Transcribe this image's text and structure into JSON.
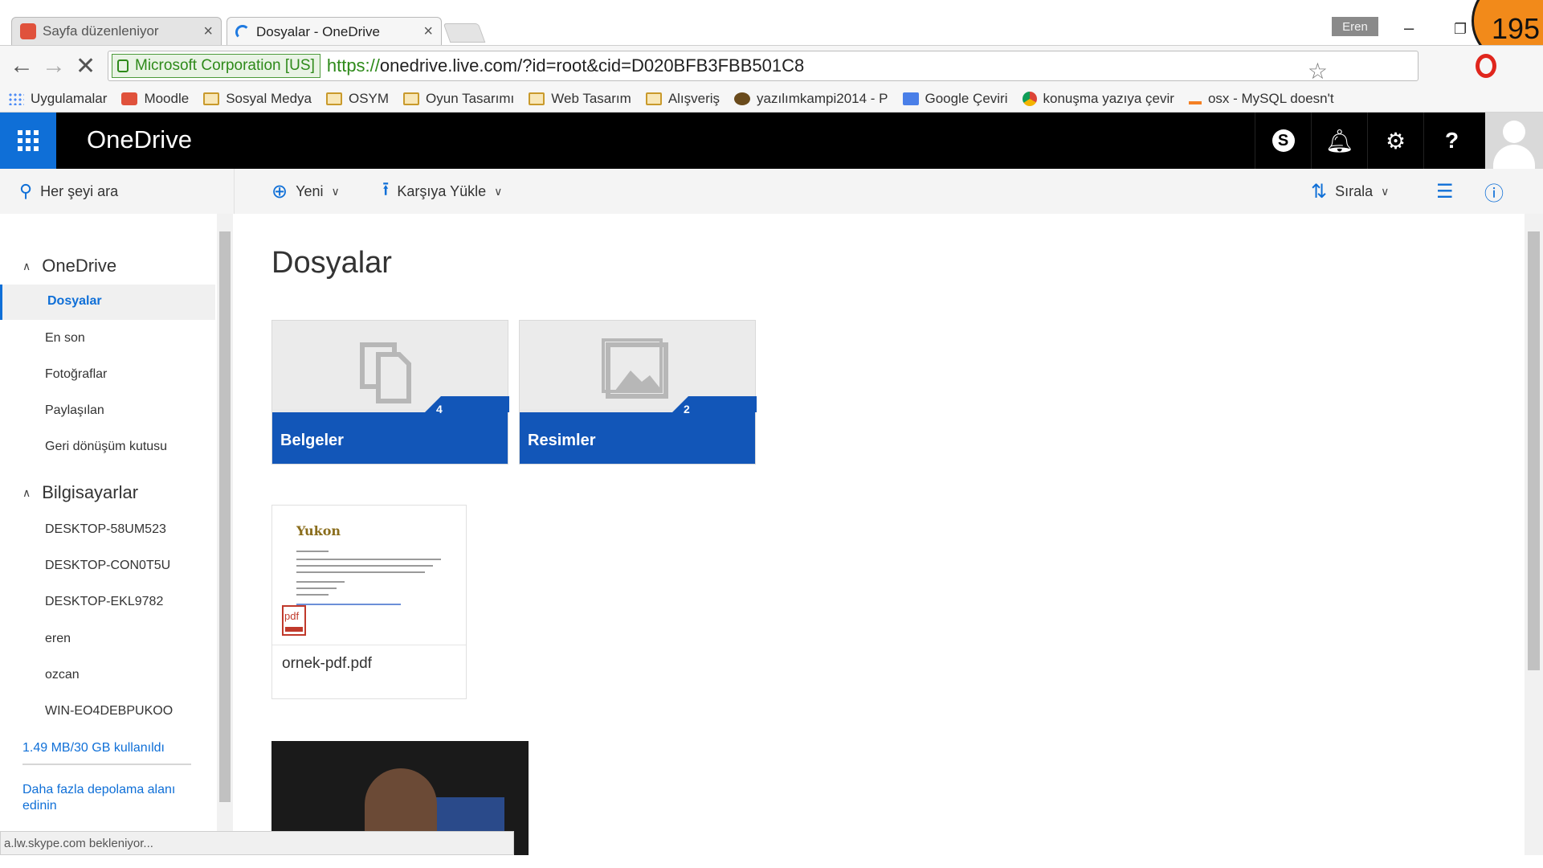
{
  "browser": {
    "tabs": [
      {
        "title": "Sayfa düzenleniyor",
        "active": false
      },
      {
        "title": "Dosyalar - OneDrive",
        "active": true
      }
    ],
    "profile_name": "Eren",
    "slide_counter": "195",
    "security_label": "Microsoft Corporation [US]",
    "url_scheme": "https://",
    "url_rest": "onedrive.live.com/?id=root&cid=D020BFB3FBB501C8",
    "bookmarks": [
      {
        "label": "Uygulamalar",
        "icon": "apps-grid-icon"
      },
      {
        "label": "Moodle",
        "icon": "moodle-icon"
      },
      {
        "label": "Sosyal Medya",
        "icon": "folder-icon"
      },
      {
        "label": "OSYM",
        "icon": "folder-icon"
      },
      {
        "label": "Oyun Tasarımı",
        "icon": "folder-icon"
      },
      {
        "label": "Web Tasarım",
        "icon": "folder-icon"
      },
      {
        "label": "Alışveriş",
        "icon": "folder-icon"
      },
      {
        "label": "yazılımkampi2014 - P",
        "icon": "site-icon"
      },
      {
        "label": "Google Çeviri",
        "icon": "translate-icon"
      },
      {
        "label": "konuşma yazıya çevir",
        "icon": "chrome-icon"
      },
      {
        "label": "osx - MySQL doesn't",
        "icon": "stackoverflow-icon"
      }
    ],
    "status_text": "a.lw.skype.com bekleniyor..."
  },
  "app": {
    "brand": "OneDrive",
    "accent": "#0f6fd7",
    "search_placeholder": "Her şeyi ara",
    "commands": {
      "new": "Yeni",
      "upload": "Karşıya Yükle",
      "sort": "Sırala"
    }
  },
  "sidebar": {
    "section_onedrive": "OneDrive",
    "items": [
      {
        "label": "Dosyalar",
        "selected": true
      },
      {
        "label": "En son"
      },
      {
        "label": "Fotoğraflar"
      },
      {
        "label": "Paylaşılan"
      },
      {
        "label": "Geri dönüşüm kutusu"
      }
    ],
    "section_computers": "Bilgisayarlar",
    "computers": [
      "DESKTOP-58UM523",
      "DESKTOP-CON0T5U",
      "DESKTOP-EKL9782",
      "eren",
      "ozcan",
      "WIN-EO4DEBPUKOO"
    ],
    "quota": "1.49 MB/30 GB kullanıldı",
    "more_storage_line1": "Daha fazla depolama alanı",
    "more_storage_line2": "edinin"
  },
  "main": {
    "title": "Dosyalar",
    "folders": [
      {
        "name": "Belgeler",
        "count": "4",
        "icon": "documents-icon"
      },
      {
        "name": "Resimler",
        "count": "2",
        "icon": "pictures-icon"
      }
    ],
    "files": [
      {
        "name": "ornek-pdf.pdf",
        "type": "pdf",
        "preview_logo": "Yukon"
      }
    ]
  }
}
